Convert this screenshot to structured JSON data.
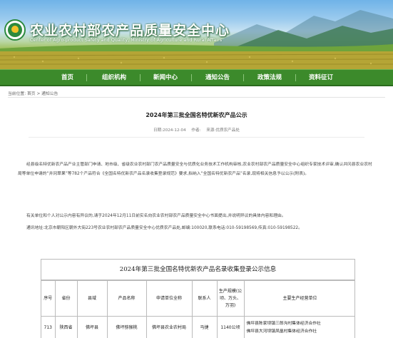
{
  "header": {
    "title": "农业农村部农产品质量安全中心",
    "subtitle": "Center of Agro-product Safety and Quality, Ministry of Agriculture and Rural Affairs"
  },
  "nav": {
    "items": [
      "首页",
      "组织机构",
      "新闻中心",
      "通知公告",
      "政策法规",
      "资料征订"
    ]
  },
  "breadcrumb": {
    "label": "当前位置:",
    "home": "首页",
    "sep": ">",
    "current": "通知公告"
  },
  "article": {
    "title": "2024年第三批全国名特优新农产品公示",
    "date_label": "日期:",
    "date": "2024-12-04",
    "views_label": "作者:",
    "views": "",
    "source_label": "来源:",
    "source": "优质农产品处",
    "para1": "经县级名特优新农产品产业主管部门申请、地市级、省级农业农村部门农产品质量安全与优质化业务技术工作机构审核,农业农村部农产品质量安全中心组织专家技术评审,确认井冈县农业农村局等单位申请的“井冈翠果”等782个产品符合《全国名特优新农产品名录收集登录规范》要求,拟纳入“全国名特优新农产品”名录,现将相关信息予以公示(附表)。",
    "para2": "有关单位和个人对公示内容有异议的,请于2024年12月11日前实名向农业农村部农产品质量安全中心书面提出,并说明异议的具体内容和理由。",
    "para3": "通讯地址:北京市朝阳区朝外大街223号农业农村部农产品质量安全中心优质农产品处,邮编:100020,联系电话:010-59198569,传真:010-59198522。"
  },
  "table": {
    "caption": "2024年第三批全国名特优新农产品名录收集登录公示信息",
    "headers": [
      "序号",
      "省份",
      "县域",
      "产品名称",
      "申请单位全称",
      "联系人",
      "生产规模(公顷、万头、万羽)",
      "主要生产经营单位"
    ],
    "rows": [
      {
        "no": "713",
        "province": "陕西省",
        "county": "佛坪县",
        "product": "佛坪猕猴桃",
        "applicant": "佛坪县农业农村局",
        "contact": "马捷",
        "scale": "1140公顷",
        "units": "佛坪县陈家坝镇三郎沟村集体经济合作社\n佛坪县大河坝镇凤凰村集体经济合作社"
      }
    ]
  },
  "colors": {
    "nav_bg": "#3c8a2b",
    "title_text": "#ffffff",
    "logo_green": "#2d8a3e"
  }
}
